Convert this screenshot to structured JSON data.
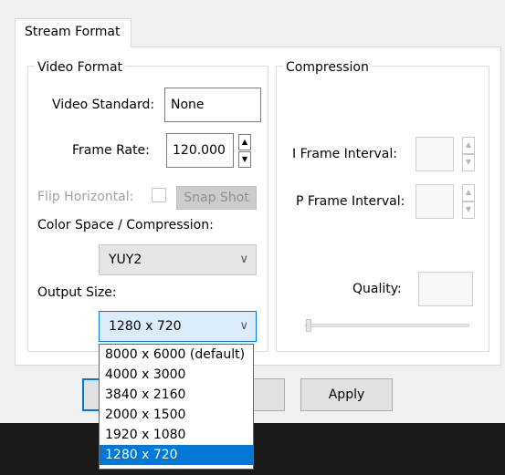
{
  "tab": {
    "label": "Stream Format"
  },
  "video_format": {
    "title": "Video Format",
    "video_standard": {
      "label": "Video Standard:",
      "value": "None"
    },
    "frame_rate": {
      "label": "Frame Rate:",
      "value": "120.000"
    },
    "flip_horizontal": {
      "label": "Flip Horizontal:",
      "checked": false
    },
    "snap_shot_label": "Snap Shot",
    "color_space": {
      "label": "Color Space / Compression:",
      "value": "YUY2"
    },
    "output_size": {
      "label": "Output Size:",
      "value": "1280 x 720"
    }
  },
  "compression": {
    "title": "Compression",
    "i_frame": {
      "label": "I Frame Interval:",
      "value": ""
    },
    "p_frame": {
      "label": "P Frame Interval:",
      "value": ""
    },
    "quality": {
      "label": "Quality:",
      "value": ""
    }
  },
  "dropdown": {
    "options": [
      "8000 x 6000  (default)",
      "4000 x 3000",
      "3840 x 2160",
      "2000 x 1500",
      "1920 x 1080",
      "1280 x 720"
    ],
    "selected": "1280 x 720"
  },
  "buttons": {
    "apply_label": "Apply"
  },
  "icons": {
    "spin_up": "spin-up-arrow-icon",
    "spin_down": "spin-down-arrow-icon",
    "chevron": "chevron-down-icon"
  },
  "colors": {
    "selection": "#0078d7",
    "taskbar": "#1a1a1a"
  }
}
